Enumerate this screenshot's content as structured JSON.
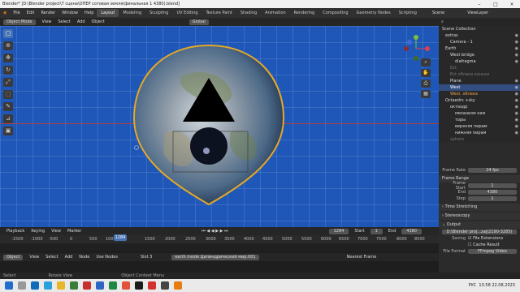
{
  "window": {
    "title": "Blender* [D:\\Blender project\\7 сцена\\ОПЕР сотовая земля(финальная 1 4380).blend]"
  },
  "menu": [
    "File",
    "Edit",
    "Render",
    "Window",
    "Help"
  ],
  "workspaces": [
    "Layout",
    "Modeling",
    "Sculpting",
    "UV Editing",
    "Texture Paint",
    "Shading",
    "Animation",
    "Rendering",
    "Compositing",
    "Geometry Nodes",
    "Scripting"
  ],
  "scene": {
    "name": "Scene",
    "view_layer": "ViewLayer"
  },
  "viewport": {
    "mode": "Object Mode",
    "menus": [
      "View",
      "Select",
      "Add",
      "Object"
    ],
    "orientation": "Global"
  },
  "timeline": {
    "menus": [
      "Playback",
      "Keying",
      "View",
      "Marker"
    ],
    "transport": "⏮ ◀ ◀ ▶ ▶ ⏭",
    "current_frame": "1284",
    "start_label": "Start",
    "start": "1",
    "end_label": "End",
    "end": "4380",
    "ticks": [
      "-1500",
      "-1000",
      "-500",
      "0",
      "500",
      "1000",
      "1500",
      "2000",
      "2500",
      "3000",
      "3500",
      "4000",
      "4500",
      "5000",
      "5500",
      "6000",
      "6500",
      "7000",
      "7500",
      "8000",
      "8500"
    ]
  },
  "node_editor": {
    "type": "Object",
    "menus": [
      "View",
      "Select",
      "Add",
      "Node"
    ],
    "use_nodes": "Use Nodes",
    "slot": "Slot 3",
    "material": "earth inside Цилиндрический мир.001",
    "snap": "Nearest Frame"
  },
  "outliner": {
    "items": [
      {
        "label": "Scene Collection"
      },
      {
        "label": "extras"
      },
      {
        "label": "Camera - 1"
      },
      {
        "label": "Earth"
      },
      {
        "label": "West bridge"
      },
      {
        "label": "diafragma"
      },
      {
        "label": "Ext"
      },
      {
        "label": "Ext облака коньки"
      },
      {
        "label": "Plane"
      },
      {
        "label": "West"
      },
      {
        "label": "West. облака"
      },
      {
        "label": "Octaedrs +sky"
      },
      {
        "label": "октаэдр"
      },
      {
        "label": "механизм кам"
      },
      {
        "label": "торы"
      },
      {
        "label": "верхняя пирам"
      },
      {
        "label": "нижняя пирам"
      },
      {
        "label": "sphere"
      }
    ]
  },
  "properties": {
    "frame_rate_label": "Frame Rate",
    "frame_rate": "24 fps",
    "frame_range_title": "Frame Range",
    "frame_start_label": "Frame Start",
    "frame_start": "1",
    "end_label": "End",
    "end": "4380",
    "step_label": "Step",
    "step": "1",
    "time_stretching": "› Time Stretching",
    "stereoscopy": "› Stereoscopy",
    "output": "⌄ Output",
    "output_path": "D:\\Blender proj...zaj(2190-3285)",
    "saving_label": "Saving",
    "file_extensions": "☑ File Extensions",
    "cache_result": "☐ Cache Result",
    "file_format_label": "File Format",
    "file_format": "FFmpeg Video"
  },
  "status": [
    "Select",
    "Rotate View",
    "Object Context Menu"
  ],
  "taskbar": {
    "lang": "РУС",
    "time": "13:58 22.08.2023"
  }
}
